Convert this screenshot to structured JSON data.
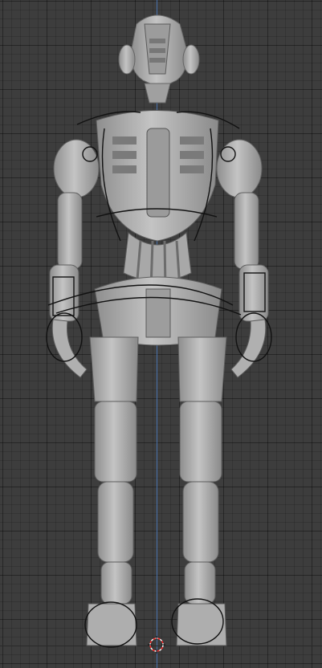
{
  "viewport": {
    "background": "#3d3d3d",
    "grid": true,
    "z_axis_color": "#4a78b8",
    "model_color": "#b7b7b7",
    "rig_color": "#111111"
  },
  "model": {
    "name": "robot-figure"
  },
  "cursor": {
    "icon": "3d-cursor-icon",
    "colors": [
      "#ffffff",
      "#ff2a2a"
    ]
  }
}
